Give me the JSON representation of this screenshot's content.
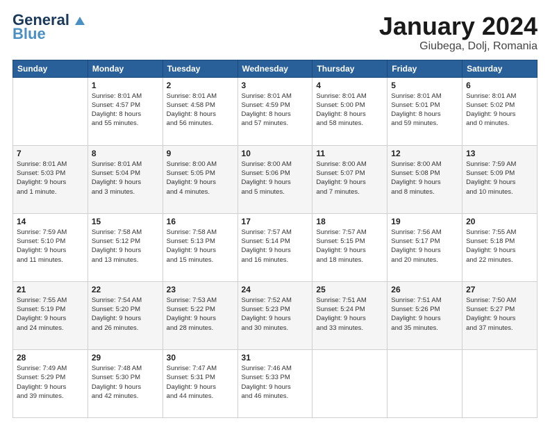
{
  "header": {
    "logo_line1": "General",
    "logo_line2": "Blue",
    "title": "January 2024",
    "location": "Giubega, Dolj, Romania"
  },
  "columns": [
    "Sunday",
    "Monday",
    "Tuesday",
    "Wednesday",
    "Thursday",
    "Friday",
    "Saturday"
  ],
  "weeks": [
    [
      {
        "day": "",
        "info": ""
      },
      {
        "day": "1",
        "info": "Sunrise: 8:01 AM\nSunset: 4:57 PM\nDaylight: 8 hours\nand 55 minutes."
      },
      {
        "day": "2",
        "info": "Sunrise: 8:01 AM\nSunset: 4:58 PM\nDaylight: 8 hours\nand 56 minutes."
      },
      {
        "day": "3",
        "info": "Sunrise: 8:01 AM\nSunset: 4:59 PM\nDaylight: 8 hours\nand 57 minutes."
      },
      {
        "day": "4",
        "info": "Sunrise: 8:01 AM\nSunset: 5:00 PM\nDaylight: 8 hours\nand 58 minutes."
      },
      {
        "day": "5",
        "info": "Sunrise: 8:01 AM\nSunset: 5:01 PM\nDaylight: 8 hours\nand 59 minutes."
      },
      {
        "day": "6",
        "info": "Sunrise: 8:01 AM\nSunset: 5:02 PM\nDaylight: 9 hours\nand 0 minutes."
      }
    ],
    [
      {
        "day": "7",
        "info": "Sunrise: 8:01 AM\nSunset: 5:03 PM\nDaylight: 9 hours\nand 1 minute."
      },
      {
        "day": "8",
        "info": "Sunrise: 8:01 AM\nSunset: 5:04 PM\nDaylight: 9 hours\nand 3 minutes."
      },
      {
        "day": "9",
        "info": "Sunrise: 8:00 AM\nSunset: 5:05 PM\nDaylight: 9 hours\nand 4 minutes."
      },
      {
        "day": "10",
        "info": "Sunrise: 8:00 AM\nSunset: 5:06 PM\nDaylight: 9 hours\nand 5 minutes."
      },
      {
        "day": "11",
        "info": "Sunrise: 8:00 AM\nSunset: 5:07 PM\nDaylight: 9 hours\nand 7 minutes."
      },
      {
        "day": "12",
        "info": "Sunrise: 8:00 AM\nSunset: 5:08 PM\nDaylight: 9 hours\nand 8 minutes."
      },
      {
        "day": "13",
        "info": "Sunrise: 7:59 AM\nSunset: 5:09 PM\nDaylight: 9 hours\nand 10 minutes."
      }
    ],
    [
      {
        "day": "14",
        "info": "Sunrise: 7:59 AM\nSunset: 5:10 PM\nDaylight: 9 hours\nand 11 minutes."
      },
      {
        "day": "15",
        "info": "Sunrise: 7:58 AM\nSunset: 5:12 PM\nDaylight: 9 hours\nand 13 minutes."
      },
      {
        "day": "16",
        "info": "Sunrise: 7:58 AM\nSunset: 5:13 PM\nDaylight: 9 hours\nand 15 minutes."
      },
      {
        "day": "17",
        "info": "Sunrise: 7:57 AM\nSunset: 5:14 PM\nDaylight: 9 hours\nand 16 minutes."
      },
      {
        "day": "18",
        "info": "Sunrise: 7:57 AM\nSunset: 5:15 PM\nDaylight: 9 hours\nand 18 minutes."
      },
      {
        "day": "19",
        "info": "Sunrise: 7:56 AM\nSunset: 5:17 PM\nDaylight: 9 hours\nand 20 minutes."
      },
      {
        "day": "20",
        "info": "Sunrise: 7:55 AM\nSunset: 5:18 PM\nDaylight: 9 hours\nand 22 minutes."
      }
    ],
    [
      {
        "day": "21",
        "info": "Sunrise: 7:55 AM\nSunset: 5:19 PM\nDaylight: 9 hours\nand 24 minutes."
      },
      {
        "day": "22",
        "info": "Sunrise: 7:54 AM\nSunset: 5:20 PM\nDaylight: 9 hours\nand 26 minutes."
      },
      {
        "day": "23",
        "info": "Sunrise: 7:53 AM\nSunset: 5:22 PM\nDaylight: 9 hours\nand 28 minutes."
      },
      {
        "day": "24",
        "info": "Sunrise: 7:52 AM\nSunset: 5:23 PM\nDaylight: 9 hours\nand 30 minutes."
      },
      {
        "day": "25",
        "info": "Sunrise: 7:51 AM\nSunset: 5:24 PM\nDaylight: 9 hours\nand 33 minutes."
      },
      {
        "day": "26",
        "info": "Sunrise: 7:51 AM\nSunset: 5:26 PM\nDaylight: 9 hours\nand 35 minutes."
      },
      {
        "day": "27",
        "info": "Sunrise: 7:50 AM\nSunset: 5:27 PM\nDaylight: 9 hours\nand 37 minutes."
      }
    ],
    [
      {
        "day": "28",
        "info": "Sunrise: 7:49 AM\nSunset: 5:29 PM\nDaylight: 9 hours\nand 39 minutes."
      },
      {
        "day": "29",
        "info": "Sunrise: 7:48 AM\nSunset: 5:30 PM\nDaylight: 9 hours\nand 42 minutes."
      },
      {
        "day": "30",
        "info": "Sunrise: 7:47 AM\nSunset: 5:31 PM\nDaylight: 9 hours\nand 44 minutes."
      },
      {
        "day": "31",
        "info": "Sunrise: 7:46 AM\nSunset: 5:33 PM\nDaylight: 9 hours\nand 46 minutes."
      },
      {
        "day": "",
        "info": ""
      },
      {
        "day": "",
        "info": ""
      },
      {
        "day": "",
        "info": ""
      }
    ]
  ]
}
